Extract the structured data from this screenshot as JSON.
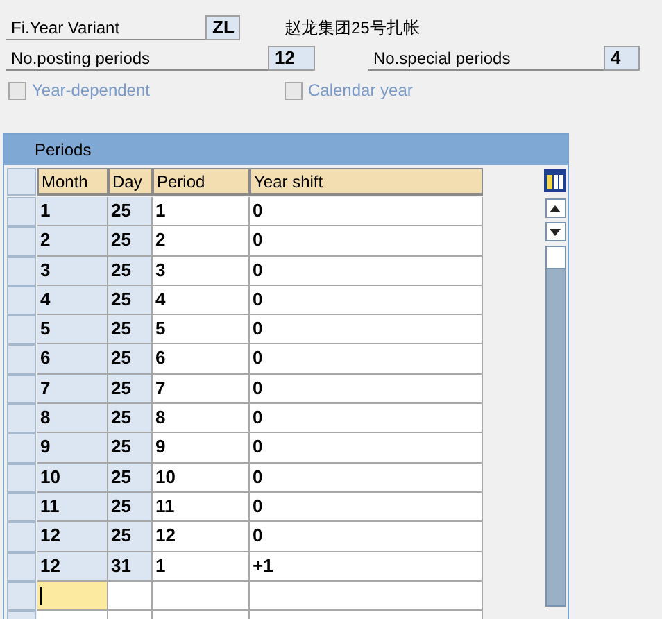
{
  "header": {
    "fields": [
      {
        "label": "Fi.Year Variant",
        "value": "ZL",
        "description": "赵龙集团25号扎帐"
      }
    ],
    "counts": [
      {
        "label": "No.posting periods",
        "value": "12"
      },
      {
        "label": "No.special periods",
        "value": "4"
      }
    ],
    "checkboxes": [
      {
        "label": "Year-dependent",
        "checked": false,
        "disabled": true
      },
      {
        "label": "Calendar year",
        "checked": false,
        "disabled": true
      }
    ]
  },
  "table": {
    "title": "Periods",
    "columns": [
      {
        "label": "Month",
        "key": true
      },
      {
        "label": "Day",
        "key": true
      },
      {
        "label": "Period",
        "key": false
      },
      {
        "label": "Year shift",
        "key": false
      }
    ],
    "rows": [
      [
        "1",
        "25",
        "1",
        "0"
      ],
      [
        "2",
        "25",
        "2",
        "0"
      ],
      [
        "3",
        "25",
        "3",
        "0"
      ],
      [
        "4",
        "25",
        "4",
        "0"
      ],
      [
        "5",
        "25",
        "5",
        "0"
      ],
      [
        "6",
        "25",
        "6",
        "0"
      ],
      [
        "7",
        "25",
        "7",
        "0"
      ],
      [
        "8",
        "25",
        "8",
        "0"
      ],
      [
        "9",
        "25",
        "9",
        "0"
      ],
      [
        "10",
        "25",
        "10",
        "0"
      ],
      [
        "11",
        "25",
        "11",
        "0"
      ],
      [
        "12",
        "25",
        "12",
        "0"
      ],
      [
        "12",
        "31",
        "1",
        "+1"
      ]
    ]
  }
}
